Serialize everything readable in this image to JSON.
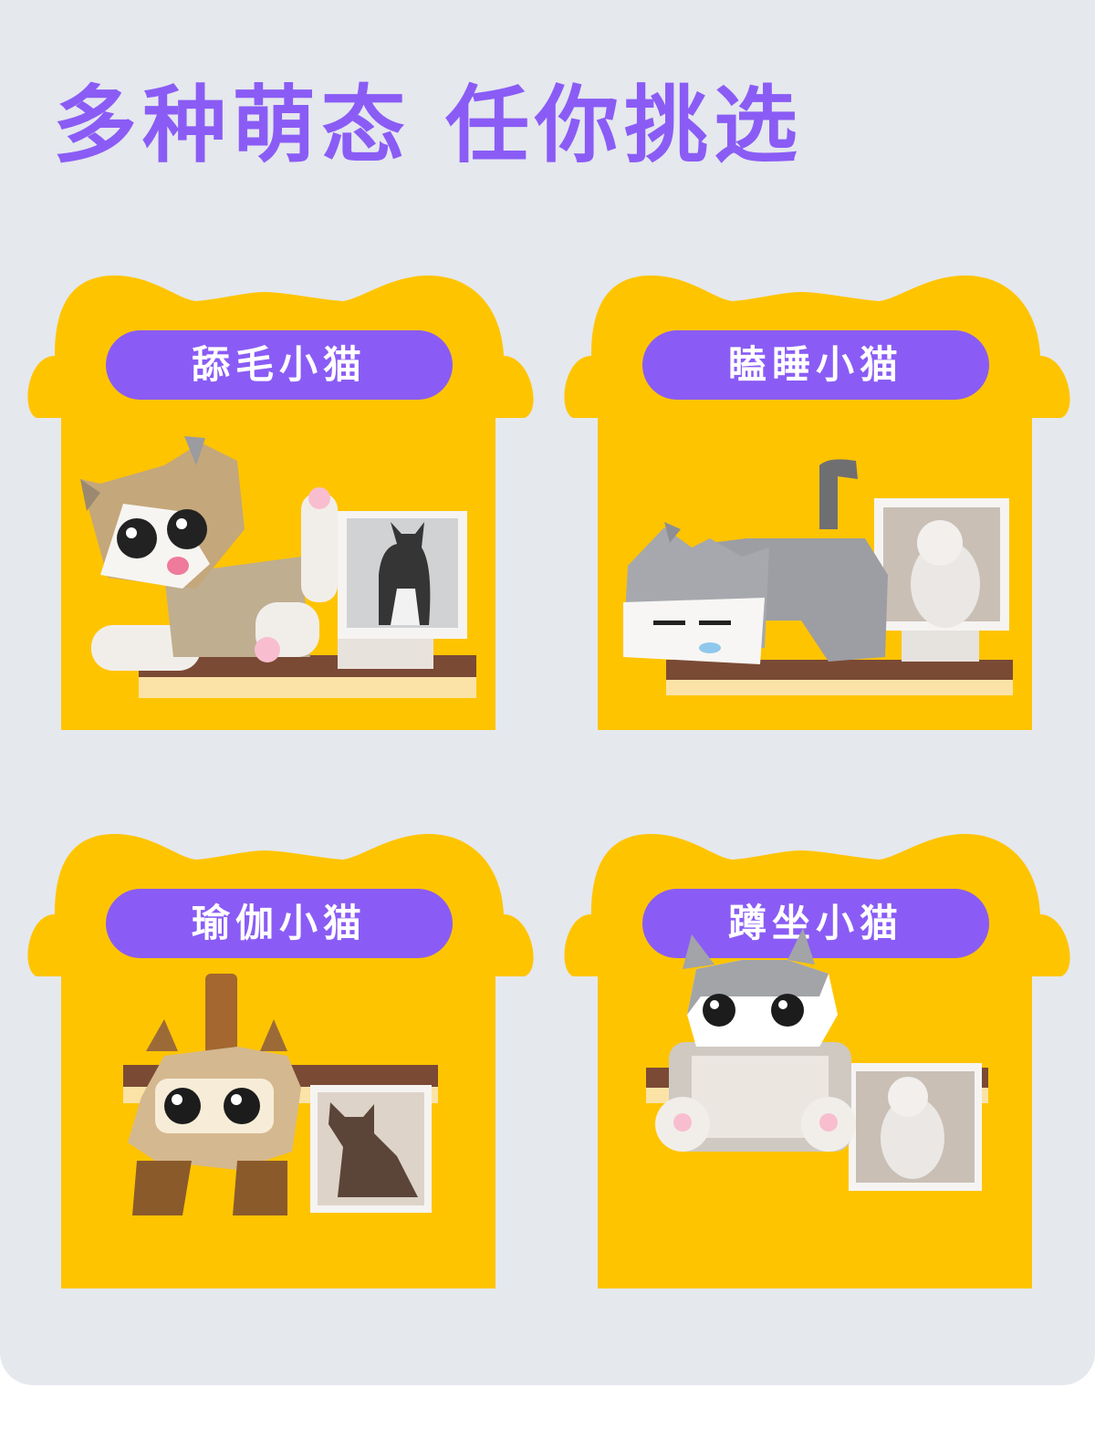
{
  "headline": "多种萌态 任你挑选",
  "colors": {
    "background": "#e5e8ed",
    "accent": "#8a5cf5",
    "house": "#ffc400"
  },
  "cards": [
    {
      "label": "舔毛小猫",
      "figure": "licking-cat-figure",
      "photo": "tuxedo-cat-photo"
    },
    {
      "label": "瞌睡小猫",
      "figure": "sleeping-cat-figure",
      "photo": "ragdoll-cat-photo"
    },
    {
      "label": "瑜伽小猫",
      "figure": "yoga-cat-figure",
      "photo": "siamese-cat-photo"
    },
    {
      "label": "蹲坐小猫",
      "figure": "sitting-cat-figure",
      "photo": "ragdoll-cat-photo"
    }
  ]
}
